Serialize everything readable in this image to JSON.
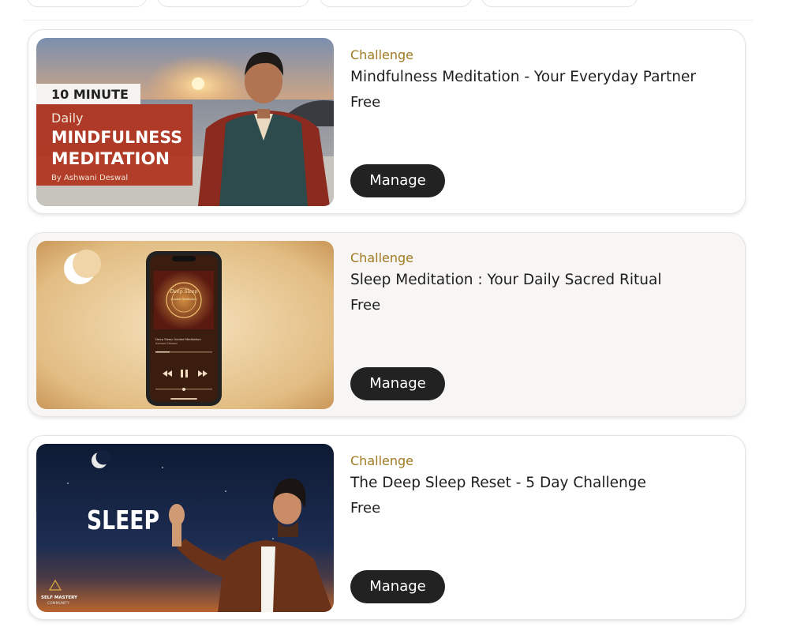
{
  "cards": [
    {
      "tag": "Challenge",
      "title": "Mindfulness Meditation - Your Everyday Partner",
      "price": "Free",
      "button": "Manage",
      "thumb": {
        "line1": "10 MINUTE",
        "line2": "Daily",
        "line3": "MINDFULNESS",
        "line4": "MEDITATION",
        "line5": "By Ashwani Deswal"
      }
    },
    {
      "tag": "Challenge",
      "title": "Sleep Meditation : Your Daily Sacred Ritual",
      "price": "Free",
      "button": "Manage",
      "thumb": {
        "app_title": "Deep Sleep",
        "app_subtitle": "Guided Meditation",
        "track": "Deep Sleep Guided Meditation",
        "artist": "Ashwani Deswal"
      }
    },
    {
      "tag": "Challenge",
      "title": "The Deep Sleep Reset - 5 Day Challenge",
      "price": "Free",
      "button": "Manage",
      "thumb": {
        "word": "SLEEP",
        "logo1": "SELF MASTERY",
        "logo2": "COMMUNITY"
      }
    }
  ],
  "colors": {
    "tag": "#a07a22",
    "button_bg": "#222222",
    "card_border": "#e4e4e4"
  }
}
